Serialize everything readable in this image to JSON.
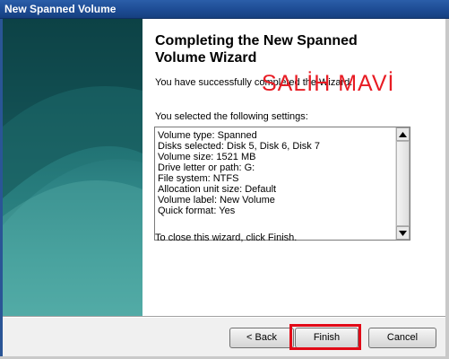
{
  "window": {
    "title": "New Spanned Volume"
  },
  "wizard": {
    "heading_line1": "Completing the New Spanned",
    "heading_line2": "Volume Wizard",
    "success_text": "You have successfully completed the Wizard.",
    "settings_label": "You selected the following settings:",
    "settings": [
      "Volume type: Spanned",
      "Disks selected: Disk 5, Disk 6, Disk 7",
      "Volume size: 1521 MB",
      "Drive letter or path: G:",
      "File system: NTFS",
      "Allocation unit size: Default",
      "Volume label: New Volume",
      "Quick format: Yes"
    ],
    "close_text": "To close this wizard, click Finish."
  },
  "watermark": {
    "text": "SALİH MAVİ",
    "color": "#e81c24"
  },
  "buttons": {
    "back": "< Back",
    "finish": "Finish",
    "cancel": "Cancel"
  },
  "highlight": {
    "color": "#e20a17"
  },
  "icons": {
    "scroll_up": "scroll-up-arrow-icon",
    "scroll_down": "scroll-down-arrow-icon"
  }
}
